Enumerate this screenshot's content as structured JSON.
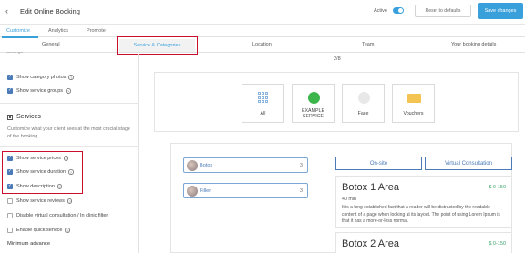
{
  "header": {
    "back_icon": "chevron-left-icon",
    "title": "Edit Online Booking",
    "active_label": "Active",
    "reset_label": "Reset to defaults",
    "save_label": "Save changes"
  },
  "main_tabs": [
    "Customize",
    "Analytics",
    "Promote"
  ],
  "sub_tabs": [
    "General",
    "Service & Categories",
    "Location",
    "Team",
    "Your booking details"
  ],
  "left": {
    "cut_text": "Settings",
    "checks_top": [
      {
        "label": "Show category photos",
        "checked": true
      },
      {
        "label": "Show service groups",
        "checked": true
      }
    ],
    "services_title": "Services",
    "services_desc": "Customize what your client sees at the most crucial stage of the booking.",
    "checks_services": [
      {
        "label": "Show service prices",
        "checked": true
      },
      {
        "label": "Show service duration",
        "checked": true
      },
      {
        "label": "Show description",
        "checked": true
      },
      {
        "label": "Show service reviews",
        "checked": false
      },
      {
        "label": "Disable virtual consultation / In clinic filter",
        "checked": false
      },
      {
        "label": "Enable quick service",
        "checked": false
      }
    ],
    "min_advance": "Minimum advance"
  },
  "preview": {
    "step": "2/8",
    "categories": [
      {
        "label": "All",
        "icon": "grid-icon"
      },
      {
        "label": "EXAMPLE SERVICE",
        "icon": "example-service-icon",
        "color": "#3cb54a"
      },
      {
        "label": "Face",
        "icon": "face-icon"
      },
      {
        "label": "Vouchers",
        "icon": "voucher-icon",
        "color": "#f3c451"
      }
    ],
    "services": [
      {
        "name": "Botox",
        "count": "3"
      },
      {
        "name": "Filler",
        "count": "3"
      }
    ],
    "location_buttons": [
      "On-site",
      "Virtual Consultation"
    ],
    "areas": [
      {
        "title": "Botox 1 Area",
        "price": "$ 0-150",
        "duration": "40 min",
        "desc": "It is a long established fact that a reader will be distracted by the readable content of a page when looking at its layout. The point of using Lorem Ipsum is that it has a more-or-less normal."
      },
      {
        "title": "Botox 2 Area",
        "price": "$ 0-150"
      }
    ]
  },
  "colors": {
    "accent": "#3aa0dc",
    "highlight": "#c8102e",
    "price": "#3ca56b",
    "service_border": "#7aa7d6"
  }
}
